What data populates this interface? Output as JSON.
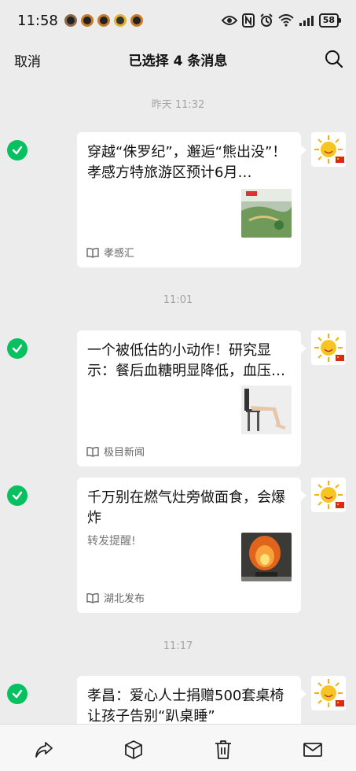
{
  "status_bar": {
    "time": "11:58",
    "battery": "58"
  },
  "nav": {
    "cancel_label": "取消",
    "title": "已选择 4 条消息"
  },
  "messages": [
    {
      "timestamp": "昨天 11:32",
      "title": "穿越“侏罗纪”，邂逅“熊出没”！孝感方特旅游区预计6月…",
      "description": "",
      "source": "孝感汇",
      "selected": true
    },
    {
      "timestamp": "11:01",
      "title": "一个被低估的小动作！研究显示：餐后血糖明显降低，血压…",
      "description": "",
      "source": "极目新闻",
      "selected": true
    },
    {
      "timestamp": "",
      "title": "千万别在燃气灶旁做面食，会爆炸",
      "description": "转发提醒!",
      "source": "湖北发布",
      "selected": true
    },
    {
      "timestamp": "11:17",
      "title": "孝昌：爱心人士捐赠500套桌椅 让孩子告别“趴桌睡”",
      "description": "",
      "source": "",
      "selected": true
    }
  ],
  "toolbar": {
    "items": [
      "share-icon",
      "box-icon",
      "trash-icon",
      "mail-icon"
    ]
  },
  "colors": {
    "accent": "#07c160",
    "background": "#ececec"
  }
}
